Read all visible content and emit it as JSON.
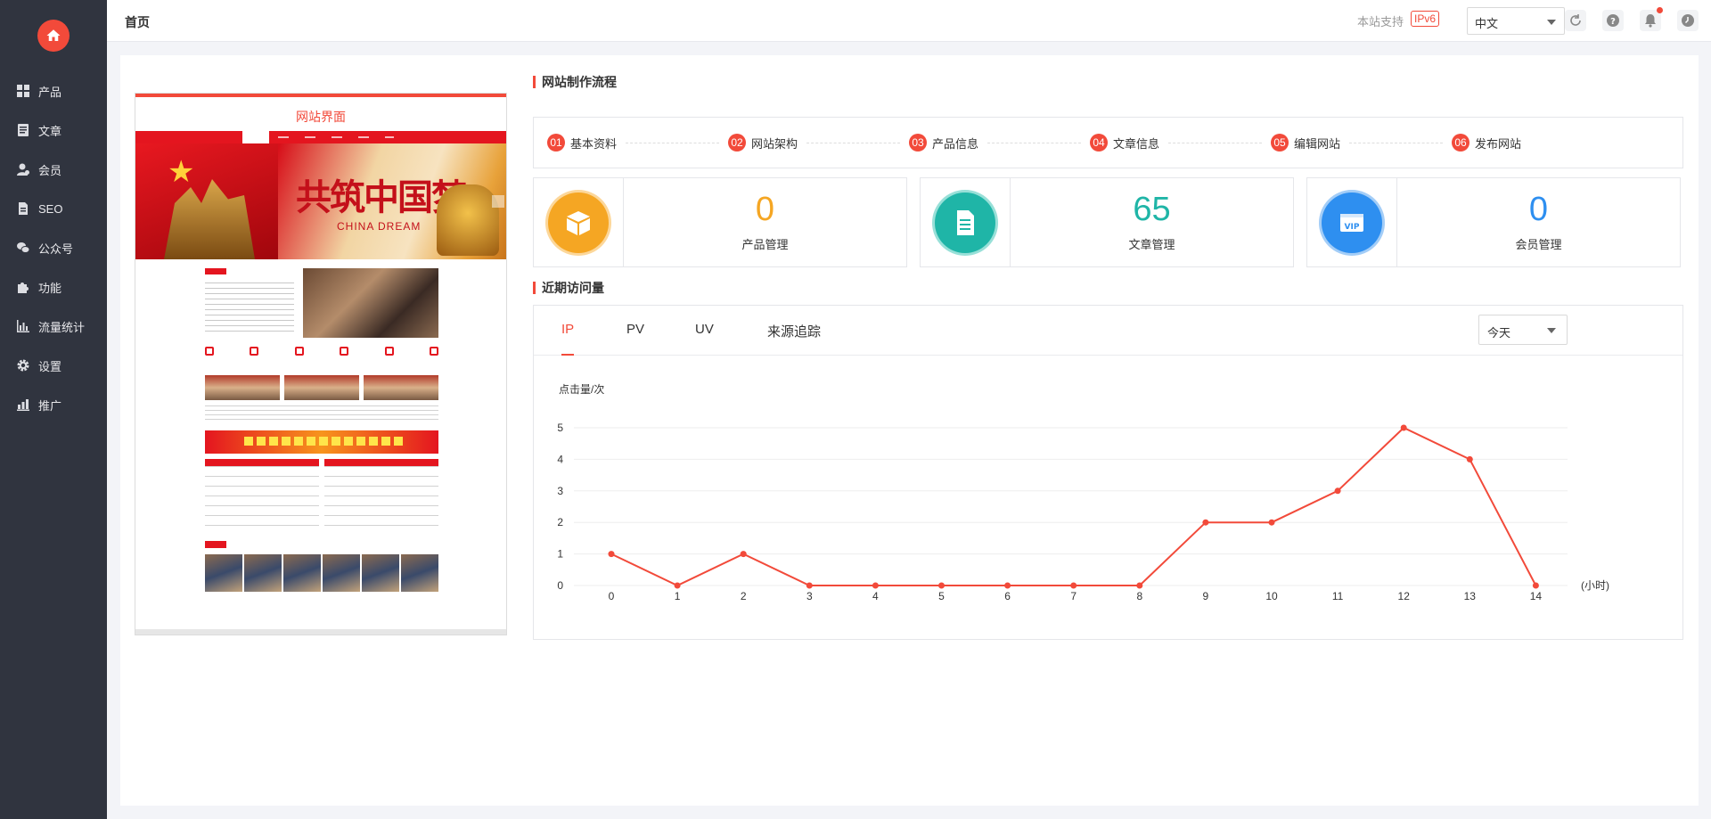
{
  "sidebar": {
    "home_icon": "home-icon",
    "items": [
      {
        "label": "产品",
        "icon": "grid-icon"
      },
      {
        "label": "文章",
        "icon": "document-icon"
      },
      {
        "label": "会员",
        "icon": "user-icon"
      },
      {
        "label": "SEO",
        "icon": "seo-icon"
      },
      {
        "label": "公众号",
        "icon": "wechat-icon"
      },
      {
        "label": "功能",
        "icon": "puzzle-icon"
      },
      {
        "label": "流量统计",
        "icon": "bar-chart-icon"
      },
      {
        "label": "设置",
        "icon": "gear-icon"
      },
      {
        "label": "推广",
        "icon": "promote-icon"
      }
    ]
  },
  "header": {
    "title": "首页",
    "ipv6_text": "本站支持",
    "ipv6_badge": "IPv6",
    "language": "中文",
    "icons": [
      "refresh-icon",
      "help-icon",
      "bell-icon",
      "clock-icon",
      "account-icon"
    ]
  },
  "preview": {
    "title": "网站界面",
    "banner_title": "共筑中国梦",
    "banner_subtitle": "CHINA DREAM"
  },
  "process": {
    "title": "网站制作流程",
    "steps": [
      {
        "num": "01",
        "label": "基本资料"
      },
      {
        "num": "02",
        "label": "网站架构"
      },
      {
        "num": "03",
        "label": "产品信息"
      },
      {
        "num": "04",
        "label": "文章信息"
      },
      {
        "num": "05",
        "label": "编辑网站"
      },
      {
        "num": "06",
        "label": "发布网站"
      }
    ]
  },
  "stats": [
    {
      "value": "0",
      "label": "产品管理",
      "color": "#f5a623",
      "icon": "box-icon"
    },
    {
      "value": "65",
      "label": "文章管理",
      "color": "#1fb5a7",
      "icon": "article-icon"
    },
    {
      "value": "0",
      "label": "会员管理",
      "color": "#2e8ff0",
      "icon": "vip-icon"
    }
  ],
  "traffic": {
    "title": "近期访问量",
    "tabs": [
      "IP",
      "PV",
      "UV",
      "来源追踪"
    ],
    "active_tab": "IP",
    "range": "今天"
  },
  "colors": {
    "accent": "#f24a3a",
    "sidebar_bg": "#30343f"
  },
  "chart_data": {
    "type": "line",
    "title": "",
    "ylabel": "点击量/次",
    "xlabel": "(小时)",
    "x": [
      0,
      1,
      2,
      3,
      4,
      5,
      6,
      7,
      8,
      9,
      10,
      11,
      12,
      13,
      14
    ],
    "series": [
      {
        "values": [
          1,
          0,
          1,
          0,
          0,
          0,
          0,
          0,
          0,
          2,
          2,
          3,
          5,
          4,
          0
        ]
      }
    ],
    "ylim": [
      0,
      5
    ],
    "yticks": [
      0,
      1,
      2,
      3,
      4,
      5
    ],
    "grid": true,
    "color": "#f24a3a"
  }
}
